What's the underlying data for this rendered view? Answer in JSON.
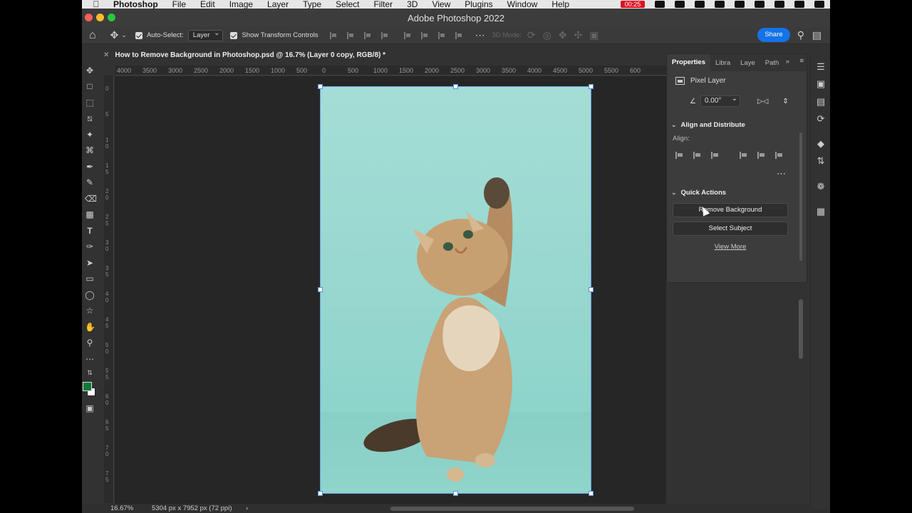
{
  "menubar": {
    "app_name": "Photoshop",
    "items": [
      "File",
      "Edit",
      "Image",
      "Layer",
      "Type",
      "Select",
      "Filter",
      "3D",
      "View",
      "Plugins",
      "Window",
      "Help"
    ],
    "rec_time": "00:25"
  },
  "window": {
    "title": "Adobe Photoshop 2022"
  },
  "options_bar": {
    "auto_select_label": "Auto-Select:",
    "auto_select_value": "Layer",
    "show_transform_label": "Show Transform Controls",
    "mode_label": "3D Mode:",
    "share_label": "Share"
  },
  "document": {
    "tab_title": "How to Remove Background in Photoshop.psd @ 16.7% (Layer 0 copy, RGB/8) *"
  },
  "ruler": {
    "top_ticks": [
      "4000",
      "3500",
      "3000",
      "2500",
      "2000",
      "1500",
      "1000",
      "500",
      "0",
      "500",
      "1000",
      "1500",
      "2000",
      "2500",
      "3000",
      "3500",
      "4000",
      "4500",
      "5000",
      "5500",
      "600"
    ],
    "left_ticks": [
      "0",
      "5",
      "1\n0",
      "1\n5",
      "2\n0",
      "2\n5",
      "3\n0",
      "3\n5",
      "4\n0",
      "4\n5",
      "5\n0",
      "5\n5",
      "6\n0",
      "6\n5",
      "7\n0",
      "7\n5"
    ]
  },
  "status": {
    "zoom": "16.67%",
    "doc_size": "5304 px x 7952 px (72 ppi)",
    "arrow": "›"
  },
  "properties": {
    "tabs": [
      "Properties",
      "Libra",
      "Laye",
      "Path"
    ],
    "layer_kind": "Pixel Layer",
    "angle": "0.00°",
    "align_header": "Align and Distribute",
    "align_label": "Align:",
    "quick_actions_header": "Quick Actions",
    "remove_bg_label": "Remove Background",
    "select_subject_label": "Select Subject",
    "view_more_label": "View More"
  },
  "colors": {
    "accent": "#1473e6",
    "foreground": "#0c7a3a",
    "background": "#ffffff",
    "canvas_bg": "#262626",
    "panel_bg": "#3c3c3c"
  }
}
